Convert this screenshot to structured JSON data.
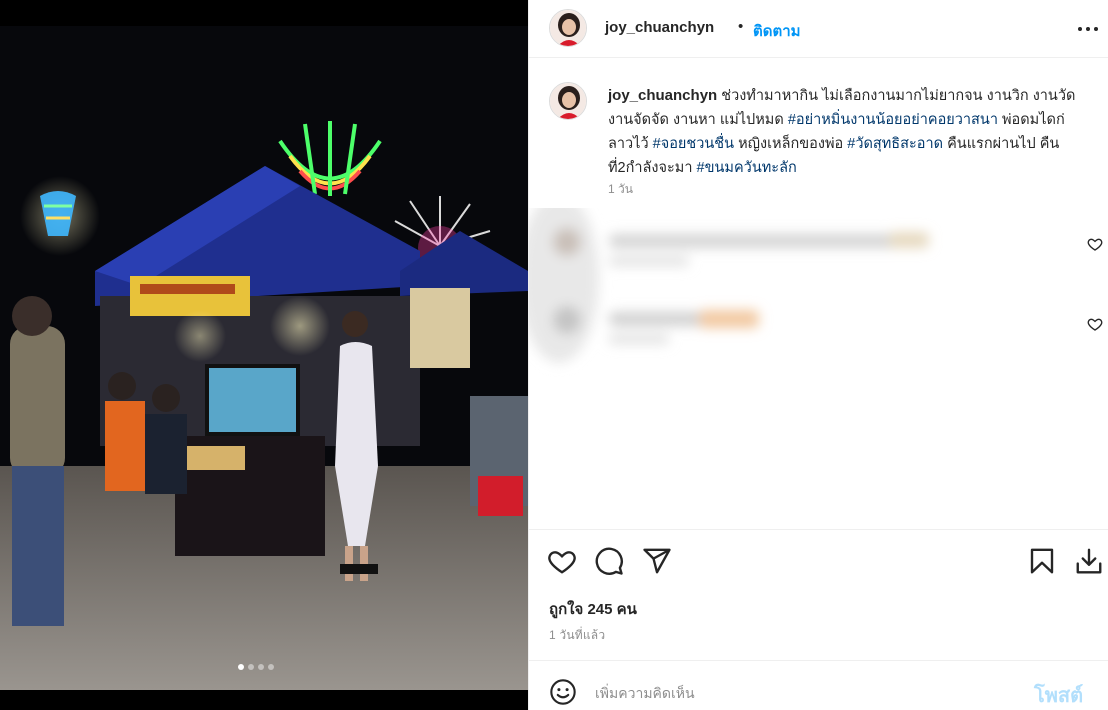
{
  "post": {
    "username": "joy_chuanchyn",
    "bullet": "•",
    "follow_label": "ติดตาม",
    "more_icon": "more-horizontal-icon"
  },
  "caption": {
    "username": "joy_chuanchyn",
    "text_1": " ช่วงทำมาหากิน ไม่เลือกงานมากไม่ยากจน งานวิก งานวัด งานจัดจัด งานหา แม่ไปหมด ",
    "tag_1": "#อย่าหมิ่นงานน้อยอย่าคอยวาสนา",
    "text_2": " พ่อดมไดก่ลาวไว้ ",
    "tag_2": "#จอยชวนชื่น",
    "text_3": " หญิงเหล็กของพ่อ ",
    "tag_3": "#วัดสุทธิสะอาด",
    "text_4": " คืนแรกผ่านไป คืนที่2กำลังจะมา ",
    "tag_4": "#ขนมควันทะลัก",
    "time": "1 วัน"
  },
  "actions": {
    "like_icon": "heart-icon",
    "comment_icon": "comment-icon",
    "share_icon": "share-icon",
    "save_icon": "bookmark-icon",
    "download_icon": "download-icon",
    "likes_text": "ถูกใจ 245 คน",
    "posted_text": "1 วันที่แล้ว"
  },
  "comment_box": {
    "emoji_icon": "emoji-icon",
    "placeholder": "เพิ่มความคิดเห็น",
    "post_label": "โพสต์"
  },
  "media": {
    "carousel_pages": 4,
    "carousel_active": 1
  },
  "colors": {
    "link": "#0095f6",
    "hashtag": "#00376b",
    "secondary_text": "#8e8e8e",
    "post_disabled": "#b2dffc"
  }
}
